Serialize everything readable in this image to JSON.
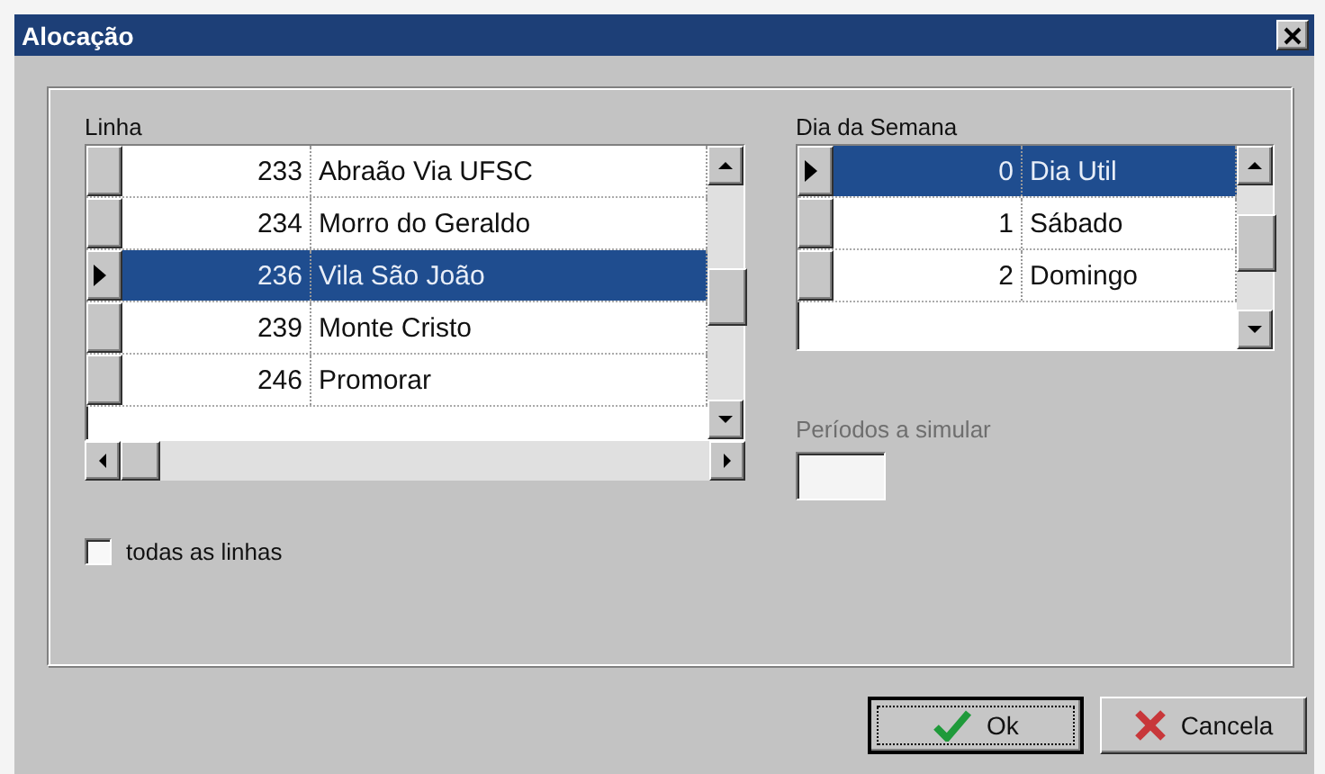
{
  "window": {
    "title": "Alocação"
  },
  "linha": {
    "label": "Linha",
    "rows": [
      {
        "number": "233",
        "name": "Abraão Via UFSC",
        "selected": false
      },
      {
        "number": "234",
        "name": "Morro do Geraldo",
        "selected": false
      },
      {
        "number": "236",
        "name": "Vila São João",
        "selected": true
      },
      {
        "number": "239",
        "name": "Monte Cristo",
        "selected": false
      },
      {
        "number": "246",
        "name": "Promorar",
        "selected": false
      }
    ]
  },
  "dia": {
    "label": "Dia da Semana",
    "rows": [
      {
        "number": "0",
        "name": "Dia Util",
        "selected": true
      },
      {
        "number": "1",
        "name": "Sábado",
        "selected": false
      },
      {
        "number": "2",
        "name": "Domingo",
        "selected": false
      }
    ]
  },
  "periodos": {
    "label": "Períodos a simular",
    "disabled": true
  },
  "todas": {
    "label": "todas as linhas",
    "checked": false
  },
  "buttons": [
    {
      "kind": "ok",
      "label": "Ok",
      "focused": true
    },
    {
      "kind": "cancel",
      "label": "Cancela",
      "focused": false
    }
  ]
}
